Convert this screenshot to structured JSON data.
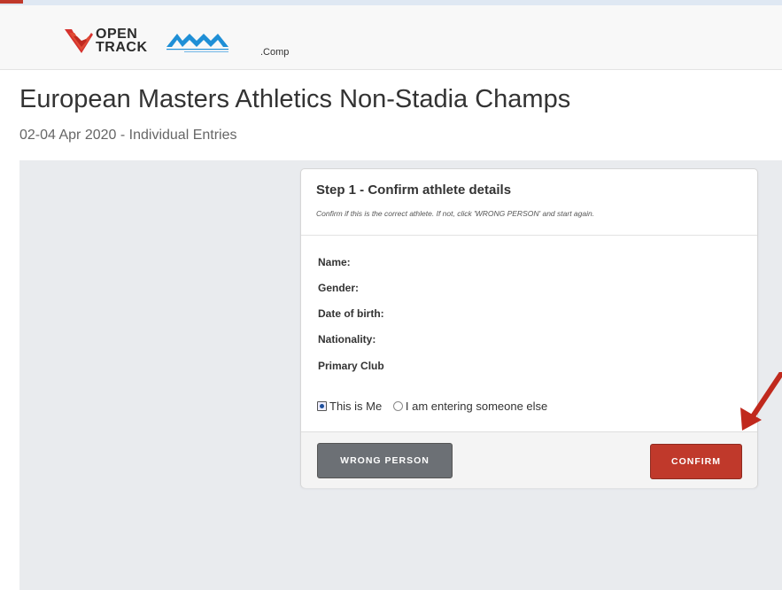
{
  "header": {
    "logo_open_line1": "OPEN",
    "logo_open_line2": "TRACK",
    "comp_suffix": ".Comp"
  },
  "page": {
    "title": "European Masters Athletics Non-Stadia Champs",
    "subtitle": "02-04 Apr 2020 - Individual Entries"
  },
  "step": {
    "title": "Step 1 - Confirm athlete details",
    "description": "Confirm if this is the correct athlete. If not, click 'WRONG PERSON' and start again.",
    "fields": [
      {
        "label": "Name:"
      },
      {
        "label": "Gender:"
      },
      {
        "label": "Date of birth:"
      },
      {
        "label": "Nationality:"
      },
      {
        "label": "Primary Club"
      }
    ],
    "radios": [
      {
        "label": "This is Me",
        "selected": true
      },
      {
        "label": "I am entering someone else",
        "selected": false
      }
    ],
    "wrong_button": "WRONG PERSON",
    "confirm_button": "CONFIRM"
  },
  "colors": {
    "confirm": "#c0392b",
    "wrong": "#6c7075",
    "emaa_logo": "#1f8fd6",
    "opentrack_logo": "#d6322e",
    "annotation_arrow": "#c0291d"
  }
}
